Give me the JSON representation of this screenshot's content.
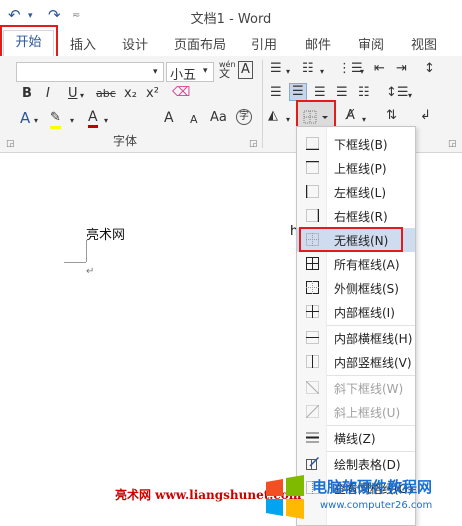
{
  "window": {
    "title": "文档1 - Word"
  },
  "tabs": [
    "开始",
    "插入",
    "设计",
    "页面布局",
    "引用",
    "邮件",
    "审阅",
    "视图"
  ],
  "ribbon": {
    "font_size": "小五",
    "wen_label": "wén",
    "font_group_label": "字体",
    "format_buttons": [
      "B",
      "I",
      "U",
      "abc",
      "x₂",
      "x²"
    ],
    "aa_buttons": [
      "A",
      "A",
      "Aa"
    ],
    "zi_symbol": "字"
  },
  "border_menu": {
    "items": [
      {
        "label": "下框线(B)",
        "icon": "border-bottom-icon",
        "enabled": true
      },
      {
        "label": "上框线(P)",
        "icon": "border-top-icon",
        "enabled": true
      },
      {
        "label": "左框线(L)",
        "icon": "border-left-icon",
        "enabled": true
      },
      {
        "label": "右框线(R)",
        "icon": "border-right-icon",
        "enabled": true
      },
      {
        "label": "无框线(N)",
        "icon": "border-none-icon",
        "enabled": true,
        "selected": true
      },
      {
        "label": "所有框线(A)",
        "icon": "border-all-icon",
        "enabled": true
      },
      {
        "label": "外侧框线(S)",
        "icon": "border-outside-icon",
        "enabled": true
      },
      {
        "label": "内部框线(I)",
        "icon": "border-inside-icon",
        "enabled": true
      },
      {
        "label": "内部横框线(H)",
        "icon": "border-inside-horizontal-icon",
        "enabled": true
      },
      {
        "label": "内部竖框线(V)",
        "icon": "border-inside-vertical-icon",
        "enabled": true
      },
      {
        "label": "斜下框线(W)",
        "icon": "diagonal-down-icon",
        "enabled": false
      },
      {
        "label": "斜上框线(U)",
        "icon": "diagonal-up-icon",
        "enabled": false
      },
      {
        "label": "横线(Z)",
        "icon": "horizontal-line-icon",
        "enabled": true
      },
      {
        "label": "绘制表格(D)",
        "icon": "draw-table-icon",
        "enabled": true
      },
      {
        "label": "查看网格线(G)",
        "icon": "view-gridlines-icon",
        "enabled": true
      }
    ]
  },
  "document": {
    "text": "亮术网",
    "partial": "h"
  },
  "watermark": {
    "left": "亮术网 www.liangshunet.com",
    "right_title": "电脑软硬件教程网",
    "right_url": "www.computer26.com"
  },
  "colors": {
    "accent": "#2b579a",
    "highlight_red": "#e21b1b",
    "selected_item": "#cfdcef"
  }
}
